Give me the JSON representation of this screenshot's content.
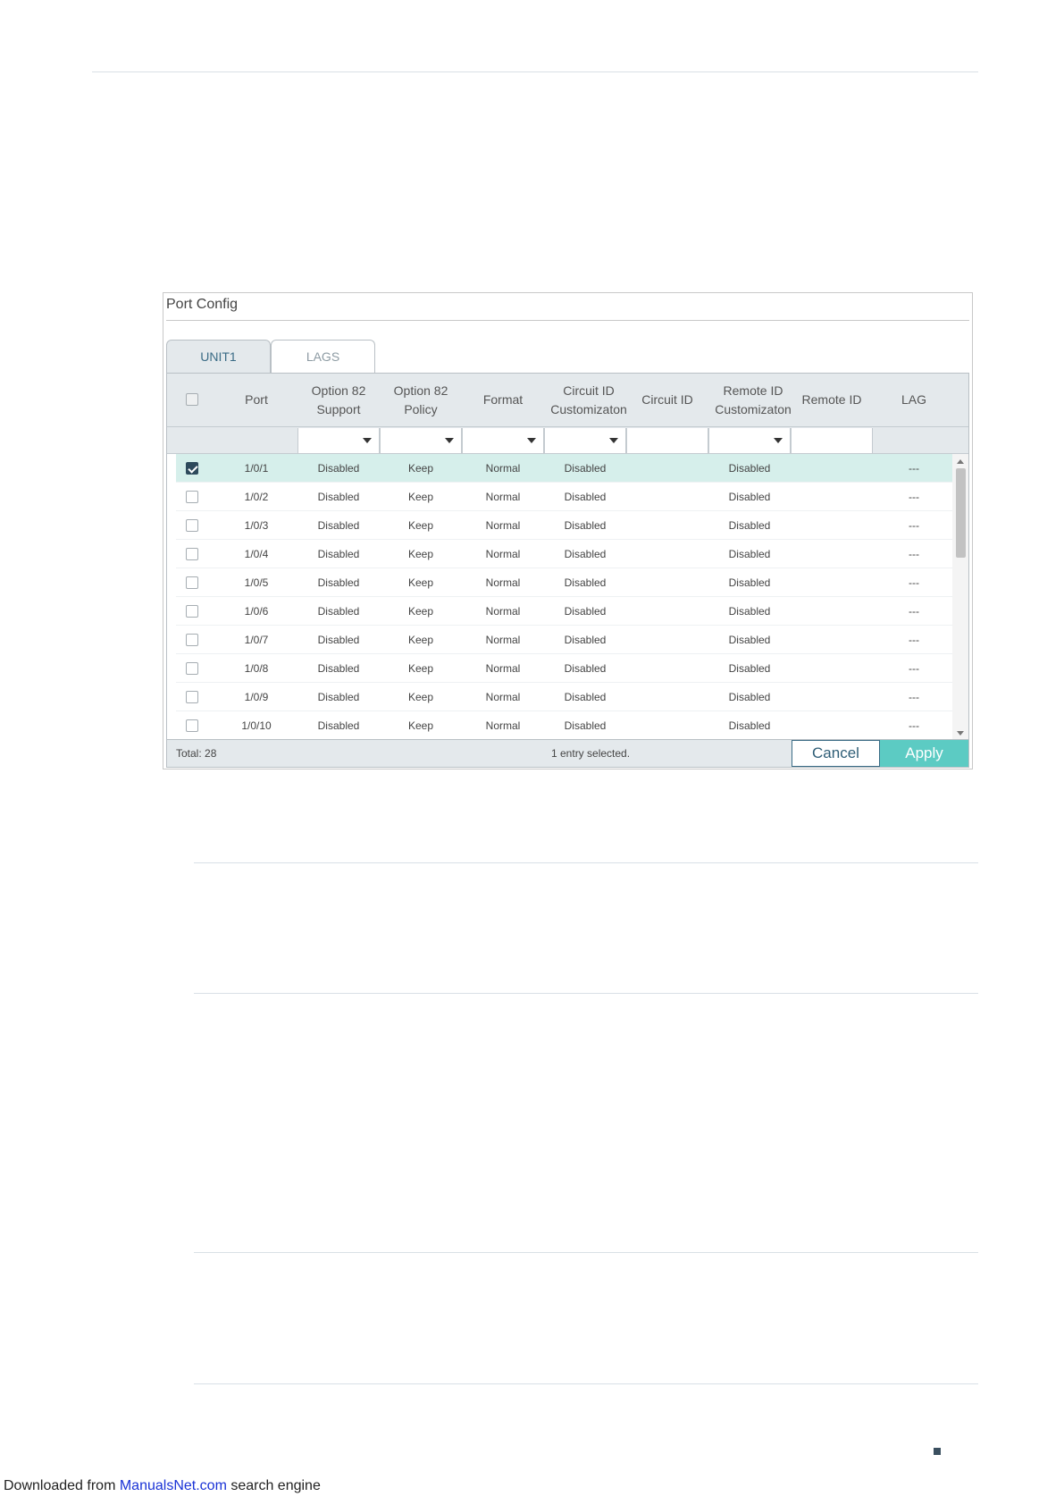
{
  "panel": {
    "title": "Port Config",
    "tabs": [
      {
        "label": "UNIT1",
        "active": true
      },
      {
        "label": "LAGS",
        "active": false
      }
    ]
  },
  "table": {
    "columns": [
      "Port",
      "Option 82\nSupport",
      "Option 82\nPolicy",
      "Format",
      "Circuit ID\nCustomizaton",
      "Circuit ID",
      "Remote ID\nCustomizaton",
      "Remote ID",
      "LAG"
    ],
    "rows": [
      {
        "port": "1/0/1",
        "support": "Disabled",
        "policy": "Keep",
        "format": "Normal",
        "circuit_cust": "Disabled",
        "circuit_id": "",
        "remote_cust": "Disabled",
        "remote_id": "",
        "lag": "---",
        "checked": true
      },
      {
        "port": "1/0/2",
        "support": "Disabled",
        "policy": "Keep",
        "format": "Normal",
        "circuit_cust": "Disabled",
        "circuit_id": "",
        "remote_cust": "Disabled",
        "remote_id": "",
        "lag": "---",
        "checked": false
      },
      {
        "port": "1/0/3",
        "support": "Disabled",
        "policy": "Keep",
        "format": "Normal",
        "circuit_cust": "Disabled",
        "circuit_id": "",
        "remote_cust": "Disabled",
        "remote_id": "",
        "lag": "---",
        "checked": false
      },
      {
        "port": "1/0/4",
        "support": "Disabled",
        "policy": "Keep",
        "format": "Normal",
        "circuit_cust": "Disabled",
        "circuit_id": "",
        "remote_cust": "Disabled",
        "remote_id": "",
        "lag": "---",
        "checked": false
      },
      {
        "port": "1/0/5",
        "support": "Disabled",
        "policy": "Keep",
        "format": "Normal",
        "circuit_cust": "Disabled",
        "circuit_id": "",
        "remote_cust": "Disabled",
        "remote_id": "",
        "lag": "---",
        "checked": false
      },
      {
        "port": "1/0/6",
        "support": "Disabled",
        "policy": "Keep",
        "format": "Normal",
        "circuit_cust": "Disabled",
        "circuit_id": "",
        "remote_cust": "Disabled",
        "remote_id": "",
        "lag": "---",
        "checked": false
      },
      {
        "port": "1/0/7",
        "support": "Disabled",
        "policy": "Keep",
        "format": "Normal",
        "circuit_cust": "Disabled",
        "circuit_id": "",
        "remote_cust": "Disabled",
        "remote_id": "",
        "lag": "---",
        "checked": false
      },
      {
        "port": "1/0/8",
        "support": "Disabled",
        "policy": "Keep",
        "format": "Normal",
        "circuit_cust": "Disabled",
        "circuit_id": "",
        "remote_cust": "Disabled",
        "remote_id": "",
        "lag": "---",
        "checked": false
      },
      {
        "port": "1/0/9",
        "support": "Disabled",
        "policy": "Keep",
        "format": "Normal",
        "circuit_cust": "Disabled",
        "circuit_id": "",
        "remote_cust": "Disabled",
        "remote_id": "",
        "lag": "---",
        "checked": false
      },
      {
        "port": "1/0/10",
        "support": "Disabled",
        "policy": "Keep",
        "format": "Normal",
        "circuit_cust": "Disabled",
        "circuit_id": "",
        "remote_cust": "Disabled",
        "remote_id": "",
        "lag": "---",
        "checked": false
      }
    ],
    "footer": {
      "total": "Total: 28",
      "selected": "1 entry selected.",
      "cancel_label": "Cancel",
      "apply_label": "Apply"
    }
  },
  "colors": {
    "accent": "#5ccbc3",
    "selected_row": "#d6efeb",
    "header_bg": "#e4e9ec"
  },
  "footer": {
    "prefix": "Downloaded from ",
    "link": "ManualsNet.com",
    "suffix": " search engine"
  }
}
